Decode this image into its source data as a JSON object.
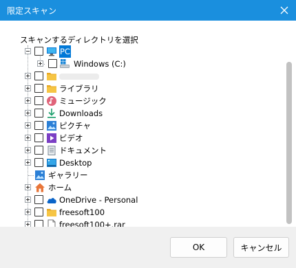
{
  "window": {
    "title": "限定スキャン"
  },
  "dialog": {
    "heading": "スキャンするディレクトリを選択"
  },
  "tree": {
    "items": [
      {
        "label": "PC",
        "icon": "pc-icon",
        "selected": true
      },
      {
        "label": "Windows (C:)",
        "icon": "windows-drive-icon"
      },
      {
        "label": "",
        "icon": "folder-icon"
      },
      {
        "label": "ライブラリ",
        "icon": "folder-icon"
      },
      {
        "label": "ミュージック",
        "icon": "music-icon"
      },
      {
        "label": "Downloads",
        "icon": "download-icon"
      },
      {
        "label": "ピクチャ",
        "icon": "pictures-icon"
      },
      {
        "label": "ビデオ",
        "icon": "video-icon"
      },
      {
        "label": "ドキュメント",
        "icon": "document-icon"
      },
      {
        "label": "Desktop",
        "icon": "desktop-icon"
      },
      {
        "label": "ギャラリー",
        "icon": "gallery-icon"
      },
      {
        "label": "ホーム",
        "icon": "home-icon"
      },
      {
        "label": "OneDrive - Personal",
        "icon": "onedrive-icon"
      },
      {
        "label": "freesoft100",
        "icon": "folder-icon"
      },
      {
        "label": "freesoft100+.rar",
        "icon": "file-icon"
      }
    ]
  },
  "buttons": {
    "ok": "OK",
    "cancel": "キャンセル"
  },
  "colors": {
    "titlebar": "#1a8fde",
    "selection": "#0078d7",
    "footer": "#f0f0f0",
    "folder": "#f6c544"
  }
}
